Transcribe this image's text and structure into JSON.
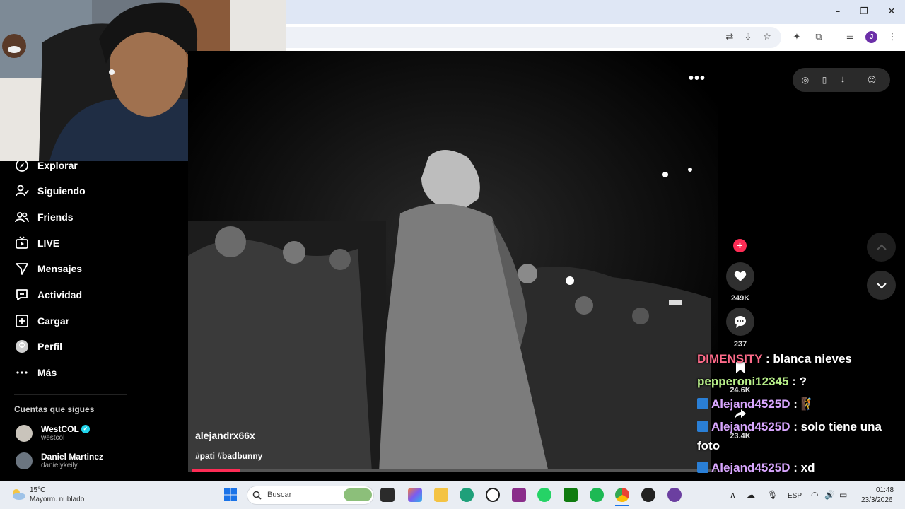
{
  "browser": {
    "window_controls": [
      "minimize",
      "maximize",
      "close"
    ],
    "profile_initial": "J"
  },
  "sidebar": {
    "nav": [
      {
        "label": "Explorar",
        "icon": "compass-icon"
      },
      {
        "label": "Siguiendo",
        "icon": "user-follow-icon"
      },
      {
        "label": "Friends",
        "icon": "friends-icon"
      },
      {
        "label": "LIVE",
        "icon": "live-tv-icon"
      },
      {
        "label": "Mensajes",
        "icon": "paper-plane-icon"
      },
      {
        "label": "Actividad",
        "icon": "activity-icon"
      },
      {
        "label": "Cargar",
        "icon": "upload-plus-icon"
      },
      {
        "label": "Perfil",
        "icon": "profile-avatar-icon"
      },
      {
        "label": "Más",
        "icon": "more-dots-icon"
      }
    ],
    "following_title": "Cuentas que sigues",
    "accounts": [
      {
        "name": "WestCOL",
        "handle": "westcol",
        "verified": true
      },
      {
        "name": "Daniel Martinez",
        "handle": "danielykeily",
        "verified": false
      }
    ]
  },
  "video": {
    "username": "alejandrx66x",
    "tags": "#pati #badbunny",
    "progress_fraction": 0.09,
    "scene": "black-and-white concert performer from behind facing crowd",
    "actions": {
      "likes": "249K",
      "comments": "237",
      "saves": "24.6K",
      "shares": "23.4K"
    }
  },
  "chat": [
    {
      "user": "DIMENSITY",
      "color": "#ff6b8a",
      "text": ": blanca nieves",
      "badge": false
    },
    {
      "user": "pepperoni12345",
      "color": "#b9f08a",
      "text": ": ?",
      "badge": false
    },
    {
      "user": "Alejand4525D",
      "color": "#d9a6ff",
      "text": ": 🧗",
      "badge": true
    },
    {
      "user": "Alejand4525D",
      "color": "#d9a6ff",
      "text": ": solo tiene una foto",
      "badge": true
    },
    {
      "user": "Alejand4525D",
      "color": "#d9a6ff",
      "text": ": xd",
      "badge": true
    }
  ],
  "taskbar": {
    "weather_temp": "15°C",
    "weather_desc": "Mayorm. nublado",
    "search_placeholder": "Buscar",
    "language": "ESP",
    "time": "01:48",
    "date": "23/3/2026"
  },
  "colors": {
    "accent": "#fe2c55",
    "chrome_title": "#dfe7f5",
    "taskbar": "#e9edf3"
  }
}
